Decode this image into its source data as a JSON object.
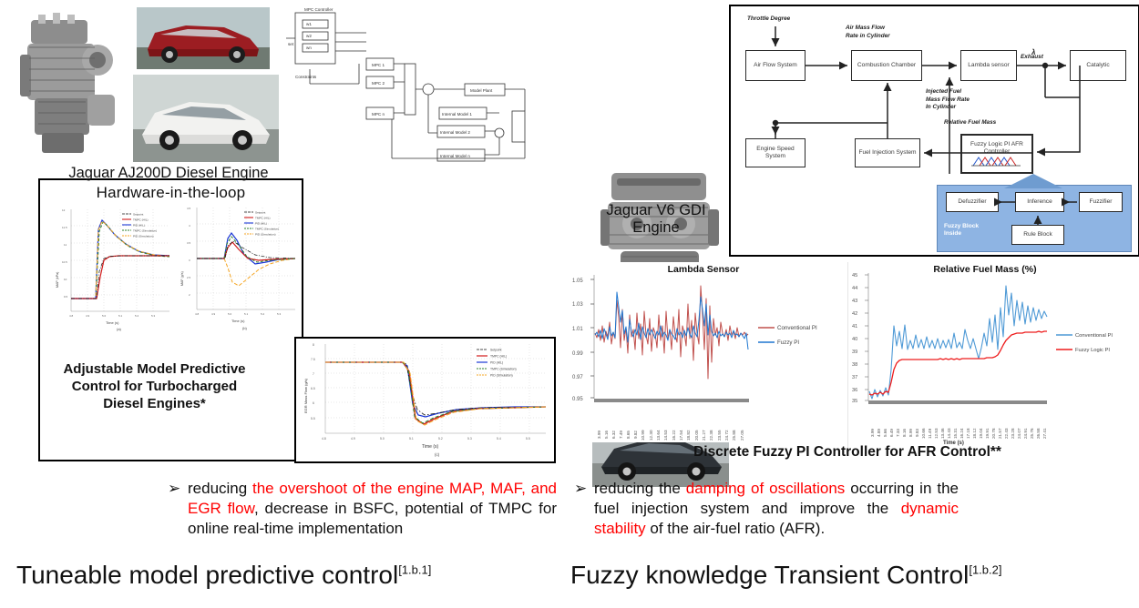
{
  "left_panel": {
    "engine_photo_name": "Jaguar AJ200D diesel engine photo",
    "engine_caption": "Jaguar AJ200D Diesel Engine",
    "car_photo_top_name": "red Jaguar F-Pace SUV photo",
    "car_photo_bottom_name": "white Jaguar XF sedan photo",
    "mpc_diagram": {
      "title": "Multiple MPC controller block diagram",
      "blocks": [
        "MPC 1",
        "MPC 2",
        "MPC n",
        "Model Plant",
        "Internal Model 1",
        "Internal Model 2",
        "Internal Model n"
      ],
      "inputs": [
        "w1",
        "w2",
        "wn"
      ]
    },
    "hil_title": "Hardware-in-the-loop",
    "charts": [
      {
        "id": "chart-a",
        "ylabel": "MAP (kPa)",
        "xlabel": "Time (s)",
        "sublabel": "(a)",
        "legend": [
          "Setpoint",
          "TMPC (HIL)",
          "PID (HIL)",
          "TMPC (Simulation)",
          "PID (Simulation)"
        ],
        "xticks": [
          "4.8",
          "4.9",
          "5.0",
          "5.1",
          "5.2",
          "5.3",
          "5.4",
          "5.5",
          "5.6",
          "5.7"
        ]
      },
      {
        "id": "chart-b",
        "ylabel": "MAF (g/s)",
        "xlabel": "Time (s)",
        "sublabel": "(b)",
        "legend": [
          "Setpoint",
          "TMPC (HIL)",
          "PID (HIL)",
          "TMPC (Simulation)",
          "PID (Simulation)"
        ],
        "xticks": [
          "4.8",
          "4.9",
          "5.0",
          "5.1",
          "5.2",
          "5.3",
          "5.4",
          "5.5",
          "5.6",
          "5.7"
        ]
      },
      {
        "id": "chart-c",
        "ylabel": "EGR Mass Flow (g/s)",
        "xlabel": "Time (s)",
        "sublabel": "(c)",
        "legend": [
          "Setpoint",
          "TMPC (HIL)",
          "PID (HIL)",
          "TMPC (Simulation)",
          "PID (Simulation)"
        ],
        "xticks": [
          "4.8",
          "4.9",
          "5.0",
          "5.1",
          "5.2",
          "5.3",
          "5.4",
          "5.5",
          "5.6",
          "5.7"
        ]
      }
    ],
    "caption_lines": [
      "Adjustable Model Predictive",
      "Control for Turbocharged",
      "Diesel Engines*"
    ],
    "bullet": {
      "marker": "➢",
      "segments": [
        {
          "text": "reducing ",
          "color": "#111111"
        },
        {
          "text": "the overshoot of the engine MAP, MAF, and EGR flow",
          "color": "#ff0000"
        },
        {
          "text": ", decrease in BSFC, potential of TMPC for online real-time implementation",
          "color": "#111111"
        }
      ]
    },
    "footer_title": "Tuneable model predictive control",
    "footer_ref": "[1.b.1]"
  },
  "right_panel": {
    "engine_photo_name": "Jaguar V6 GDI engine photo",
    "car_photo_name": "dark Jaguar XF sedan photo",
    "engine_caption_line1": "Jaguar V6 GDI",
    "engine_caption_line2": "Engine",
    "afr_diagram": {
      "title": "Fuzzy logic PI AFR control block diagram",
      "blocks": [
        "Air Flow System",
        "Combustion Chamber",
        "Lambda sensor",
        "Catalytic",
        "Engine Speed System",
        "Fuel Injection System",
        "Fuzzy Logic PI AFR Controller",
        "Defuzzifier",
        "Inference",
        "Fuzzifier",
        "Rule Block"
      ],
      "signal_labels": [
        "Throttle Degree",
        "Air Mass Flow Rate in Cylinder",
        "Exhaust",
        "λ",
        "Injected Fuel Mass Flow Rate in Cylinder",
        "Relative Fuel Mass"
      ],
      "fuzzy_panel_label": "Fuzzy Block Inside"
    },
    "caption": "Discrete Fuzzy PI Controller for AFR Control**",
    "bullet": {
      "marker": "➢",
      "segments": [
        {
          "text": "reducing the ",
          "color": "#111111"
        },
        {
          "text": "damping of oscillations",
          "color": "#ff0000"
        },
        {
          "text": " occurring in the fuel injection system and improve the ",
          "color": "#111111"
        },
        {
          "text": "dynamic stability",
          "color": "#ff0000"
        },
        {
          "text": " of the air-fuel ratio (AFR).",
          "color": "#111111"
        }
      ]
    },
    "footer_title": "Fuzzy knowledge Transient Control",
    "footer_ref": "[1.b.2]"
  },
  "chart_data": [
    {
      "type": "line",
      "id": "lambda-sensor",
      "title": "Lambda Sensor",
      "xlabel": "",
      "ylabel": "",
      "ylim": [
        0.95,
        1.05
      ],
      "yticks": [
        "1.05",
        "1.03",
        "1.01",
        "0.99",
        "0.97",
        "0.95"
      ],
      "xticks": [
        "3.99",
        "5.16",
        "6.32",
        "7.49",
        "8.65",
        "9.82",
        "10.99",
        "12.30",
        "13.64",
        "14.53",
        "16.22",
        "17.54",
        "18.82",
        "20.05",
        "21.27",
        "22.38",
        "23.55",
        "24.72",
        "25.88",
        "27.05"
      ],
      "grid": false,
      "legend_position": "right",
      "series": [
        {
          "name": "Conventional PI",
          "color": "#c0504d",
          "values": [
            1.002,
            0.998,
            1.004,
            0.996,
            1.01,
            0.992,
            1.006,
            0.999,
            1.012,
            0.99,
            1.003,
            0.997,
            1.03,
            1.012,
            0.986,
            1.022,
            0.994,
            1.008,
            0.98,
            1.016,
            0.998,
            1.006,
            0.985,
            1.018,
            0.996,
            1.012,
            0.982,
            1.02,
            1.0,
            0.99,
            1.014,
            0.984,
            1.008,
            1.002,
            0.988,
            1.016,
            0.994,
            1.01,
            0.98,
            1.02,
            0.996,
            1.006,
            0.986,
            1.014,
            1.0,
            0.992,
            1.018,
            0.984,
            1.01,
            0.998,
            1.004,
            0.988,
            1.022,
            0.994,
            1.012,
            0.978,
            1.016,
            1.002,
            0.99,
            1.048,
            1.02,
            0.985,
            1.034,
            0.96,
            1.028,
            0.972,
            1.014,
            0.996,
            1.006,
            0.988,
            1.012,
            0.998,
            1.002,
            0.994,
            1.008,
            0.99,
            1.004,
            1.0,
            0.996,
            1.006,
            0.992,
            1.002,
            0.998,
            1.004,
            0.995,
            1.003
          ]
        },
        {
          "name": "Fuzzy PI",
          "color": "#1f77d0",
          "values": [
            1.0,
            1.002,
            0.999,
            1.003,
            0.998,
            1.004,
            1.001,
            0.997,
            1.005,
            0.999,
            1.002,
            0.998,
            1.036,
            1.024,
            1.008,
            1.018,
            1.0,
            1.006,
            0.996,
            1.01,
            1.002,
            0.998,
            1.004,
            1.0,
            1.006,
            0.996,
            1.008,
            1.002,
            0.998,
            1.004,
            0.999,
            1.005,
            1.001,
            0.997,
            1.003,
            1.0,
            1.006,
            0.998,
            1.004,
            1.0,
            0.996,
            1.002,
            1.005,
            0.999,
            1.003,
            1.001,
            0.997,
            1.004,
            1.0,
            1.002,
            0.998,
            1.006,
            1.0,
            1.003,
            0.997,
            1.005,
            1.001,
            0.999,
            1.012,
            1.032,
            1.018,
            1.006,
            1.022,
            1.0,
            1.014,
            0.996,
            1.008,
            1.002,
            1.0,
            1.004,
            0.998,
            1.002,
            1.0,
            1.003,
            0.999,
            1.001,
            1.002,
            0.998,
            1.004,
            1.0,
            1.001,
            0.999,
            1.002,
            1.0,
            0.998,
            1.001
          ]
        }
      ]
    },
    {
      "type": "line",
      "id": "relative-fuel-mass",
      "title": "Relative Fuel Mass (%)",
      "xlabel": "Time (s)",
      "ylabel": "",
      "ylim": [
        35,
        45
      ],
      "yticks": [
        "45",
        "44",
        "43",
        "42",
        "41",
        "40",
        "39",
        "38",
        "37",
        "36",
        "35"
      ],
      "xticks": [
        "3.99",
        "4.89",
        "5.66",
        "6.49",
        "7.33",
        "8.16",
        "8.99",
        "9.83",
        "10.66",
        "11.49",
        "12.53",
        "13.46",
        "14.43",
        "15.31",
        "16.24",
        "17.18",
        "18.12",
        "19.04",
        "19.91",
        "20.78",
        "21.57",
        "22.43",
        "23.28",
        "24.07",
        "24.91",
        "25.76",
        "26.58",
        "27.41"
      ],
      "grid": false,
      "legend_position": "right",
      "series": [
        {
          "name": "Conventional PI",
          "color": "#4f9ad6",
          "values": [
            35.8,
            35.3,
            36.0,
            35.4,
            35.9,
            35.5,
            36.2,
            35.6,
            38.0,
            40.0,
            38.4,
            39.4,
            38.2,
            40.1,
            38.1,
            38.8,
            38.2,
            39.3,
            38.3,
            38.9,
            38.2,
            39.1,
            38.3,
            38.8,
            38.2,
            39.0,
            38.2,
            38.9,
            38.3,
            38.8,
            38.2,
            39.2,
            38.3,
            38.7,
            38.2,
            39.4,
            38.8,
            38.2,
            39.0,
            38.2,
            37.6,
            38.3,
            39.2,
            38.4,
            39.9,
            38.6,
            40.2,
            38.0,
            40.6,
            39.0,
            43.3,
            40.6,
            42.6,
            39.8,
            42.0,
            40.8,
            41.9,
            40.4,
            41.6,
            40.2,
            41.4,
            40.6,
            41.3,
            40.4,
            41.2,
            40.5,
            41.1,
            40.3,
            41.0,
            40.5,
            40.9,
            40.6,
            41.1,
            40.4,
            40.9,
            40.6,
            41.0,
            40.5,
            40.8,
            40.6,
            41.0,
            40.7
          ]
        },
        {
          "name": "Fuzzy Logic PI",
          "color": "#ee1c1c",
          "values": [
            35.6,
            35.5,
            35.7,
            35.6,
            35.8,
            35.6,
            35.9,
            35.8,
            36.6,
            37.6,
            38.1,
            38.3,
            38.4,
            38.4,
            38.4,
            38.4,
            38.4,
            38.4,
            38.4,
            38.4,
            38.4,
            38.4,
            38.4,
            38.4,
            38.4,
            38.4,
            38.5,
            38.4,
            38.5,
            38.4,
            38.5,
            38.4,
            38.5,
            38.4,
            38.5,
            38.5,
            38.5,
            38.5,
            38.5,
            38.5,
            38.5,
            38.5,
            38.5,
            38.6,
            38.6,
            38.6,
            38.7,
            38.8,
            39.2,
            39.6,
            40.0,
            40.2,
            40.4,
            40.5,
            40.6,
            40.6,
            40.6,
            40.7,
            40.7,
            40.7,
            40.7,
            40.7,
            40.7,
            40.7,
            40.7,
            40.7,
            40.7,
            40.7,
            40.7,
            40.7,
            40.7,
            40.7,
            40.8,
            40.7,
            40.8,
            40.7,
            40.8,
            40.8,
            40.8,
            40.8,
            40.8,
            40.8
          ]
        }
      ]
    }
  ]
}
